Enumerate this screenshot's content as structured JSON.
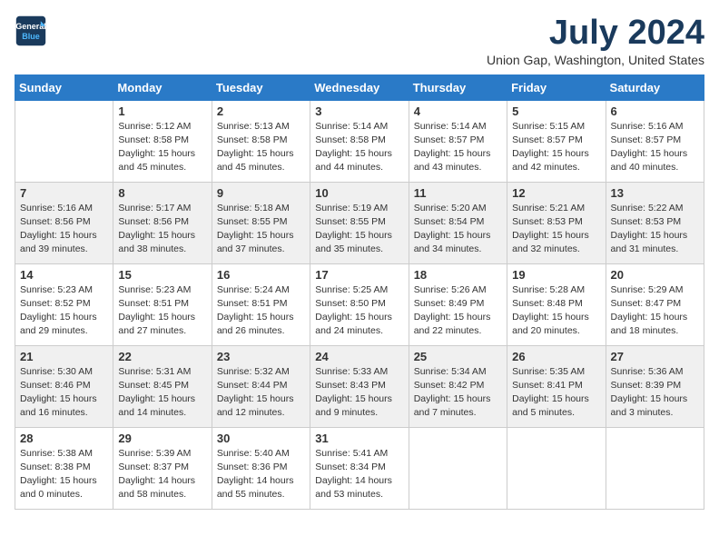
{
  "logo": {
    "line1": "General",
    "line2": "Blue"
  },
  "title": "July 2024",
  "location": "Union Gap, Washington, United States",
  "weekdays": [
    "Sunday",
    "Monday",
    "Tuesday",
    "Wednesday",
    "Thursday",
    "Friday",
    "Saturday"
  ],
  "weeks": [
    [
      {
        "day": "",
        "info": ""
      },
      {
        "day": "1",
        "info": "Sunrise: 5:12 AM\nSunset: 8:58 PM\nDaylight: 15 hours\nand 45 minutes."
      },
      {
        "day": "2",
        "info": "Sunrise: 5:13 AM\nSunset: 8:58 PM\nDaylight: 15 hours\nand 45 minutes."
      },
      {
        "day": "3",
        "info": "Sunrise: 5:14 AM\nSunset: 8:58 PM\nDaylight: 15 hours\nand 44 minutes."
      },
      {
        "day": "4",
        "info": "Sunrise: 5:14 AM\nSunset: 8:57 PM\nDaylight: 15 hours\nand 43 minutes."
      },
      {
        "day": "5",
        "info": "Sunrise: 5:15 AM\nSunset: 8:57 PM\nDaylight: 15 hours\nand 42 minutes."
      },
      {
        "day": "6",
        "info": "Sunrise: 5:16 AM\nSunset: 8:57 PM\nDaylight: 15 hours\nand 40 minutes."
      }
    ],
    [
      {
        "day": "7",
        "info": "Sunrise: 5:16 AM\nSunset: 8:56 PM\nDaylight: 15 hours\nand 39 minutes."
      },
      {
        "day": "8",
        "info": "Sunrise: 5:17 AM\nSunset: 8:56 PM\nDaylight: 15 hours\nand 38 minutes."
      },
      {
        "day": "9",
        "info": "Sunrise: 5:18 AM\nSunset: 8:55 PM\nDaylight: 15 hours\nand 37 minutes."
      },
      {
        "day": "10",
        "info": "Sunrise: 5:19 AM\nSunset: 8:55 PM\nDaylight: 15 hours\nand 35 minutes."
      },
      {
        "day": "11",
        "info": "Sunrise: 5:20 AM\nSunset: 8:54 PM\nDaylight: 15 hours\nand 34 minutes."
      },
      {
        "day": "12",
        "info": "Sunrise: 5:21 AM\nSunset: 8:53 PM\nDaylight: 15 hours\nand 32 minutes."
      },
      {
        "day": "13",
        "info": "Sunrise: 5:22 AM\nSunset: 8:53 PM\nDaylight: 15 hours\nand 31 minutes."
      }
    ],
    [
      {
        "day": "14",
        "info": "Sunrise: 5:23 AM\nSunset: 8:52 PM\nDaylight: 15 hours\nand 29 minutes."
      },
      {
        "day": "15",
        "info": "Sunrise: 5:23 AM\nSunset: 8:51 PM\nDaylight: 15 hours\nand 27 minutes."
      },
      {
        "day": "16",
        "info": "Sunrise: 5:24 AM\nSunset: 8:51 PM\nDaylight: 15 hours\nand 26 minutes."
      },
      {
        "day": "17",
        "info": "Sunrise: 5:25 AM\nSunset: 8:50 PM\nDaylight: 15 hours\nand 24 minutes."
      },
      {
        "day": "18",
        "info": "Sunrise: 5:26 AM\nSunset: 8:49 PM\nDaylight: 15 hours\nand 22 minutes."
      },
      {
        "day": "19",
        "info": "Sunrise: 5:28 AM\nSunset: 8:48 PM\nDaylight: 15 hours\nand 20 minutes."
      },
      {
        "day": "20",
        "info": "Sunrise: 5:29 AM\nSunset: 8:47 PM\nDaylight: 15 hours\nand 18 minutes."
      }
    ],
    [
      {
        "day": "21",
        "info": "Sunrise: 5:30 AM\nSunset: 8:46 PM\nDaylight: 15 hours\nand 16 minutes."
      },
      {
        "day": "22",
        "info": "Sunrise: 5:31 AM\nSunset: 8:45 PM\nDaylight: 15 hours\nand 14 minutes."
      },
      {
        "day": "23",
        "info": "Sunrise: 5:32 AM\nSunset: 8:44 PM\nDaylight: 15 hours\nand 12 minutes."
      },
      {
        "day": "24",
        "info": "Sunrise: 5:33 AM\nSunset: 8:43 PM\nDaylight: 15 hours\nand 9 minutes."
      },
      {
        "day": "25",
        "info": "Sunrise: 5:34 AM\nSunset: 8:42 PM\nDaylight: 15 hours\nand 7 minutes."
      },
      {
        "day": "26",
        "info": "Sunrise: 5:35 AM\nSunset: 8:41 PM\nDaylight: 15 hours\nand 5 minutes."
      },
      {
        "day": "27",
        "info": "Sunrise: 5:36 AM\nSunset: 8:39 PM\nDaylight: 15 hours\nand 3 minutes."
      }
    ],
    [
      {
        "day": "28",
        "info": "Sunrise: 5:38 AM\nSunset: 8:38 PM\nDaylight: 15 hours\nand 0 minutes."
      },
      {
        "day": "29",
        "info": "Sunrise: 5:39 AM\nSunset: 8:37 PM\nDaylight: 14 hours\nand 58 minutes."
      },
      {
        "day": "30",
        "info": "Sunrise: 5:40 AM\nSunset: 8:36 PM\nDaylight: 14 hours\nand 55 minutes."
      },
      {
        "day": "31",
        "info": "Sunrise: 5:41 AM\nSunset: 8:34 PM\nDaylight: 14 hours\nand 53 minutes."
      },
      {
        "day": "",
        "info": ""
      },
      {
        "day": "",
        "info": ""
      },
      {
        "day": "",
        "info": ""
      }
    ]
  ]
}
